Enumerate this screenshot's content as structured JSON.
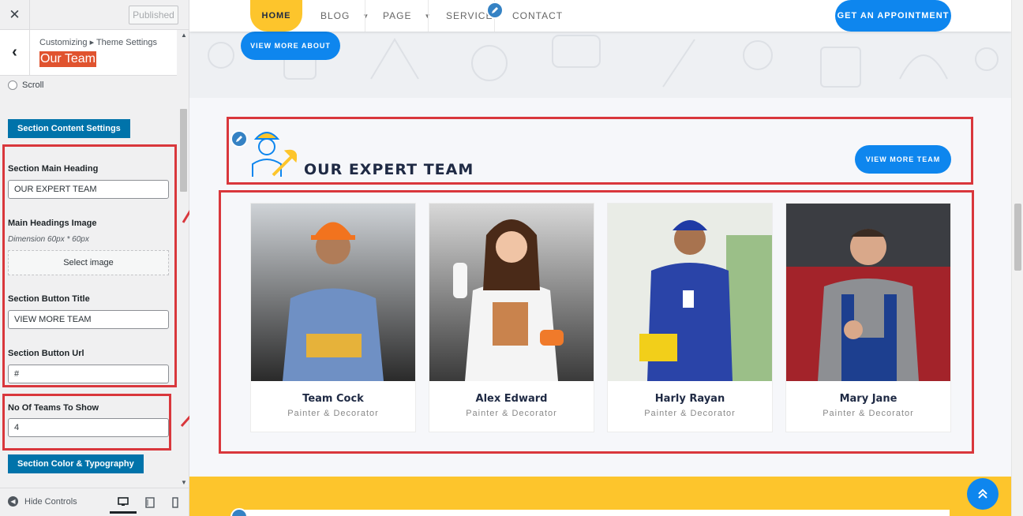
{
  "sidebar": {
    "published_label": "Published",
    "breadcrumb": "Customizing ▸ Theme Settings",
    "section_title": "Our Team",
    "scroll_option": "Scroll",
    "content_settings_label": "Section Content Settings",
    "main_heading_label": "Section Main Heading",
    "main_heading_value": "OUR EXPERT TEAM",
    "headings_image_label": "Main Headings Image",
    "headings_image_dimension": "Dimension 60px * 60px",
    "select_image_label": "Select image",
    "button_title_label": "Section Button Title",
    "button_title_value": "VIEW MORE TEAM",
    "button_url_label": "Section Button Url",
    "button_url_value": "#",
    "teams_count_label": "No Of Teams To Show",
    "teams_count_value": "4",
    "color_typography_label": "Section Color & Typography",
    "hide_controls_label": "Hide Controls"
  },
  "nav": {
    "home": "HOME",
    "blog": "BLOG",
    "page": "PAGE",
    "service": "SERVICE",
    "contact": "CONTACT",
    "appointment": "GET AN APPOINTMENT"
  },
  "about": {
    "view_more": "VIEW MORE ABOUT"
  },
  "team": {
    "heading": "OUR EXPERT TEAM",
    "view_more": "VIEW MORE TEAM",
    "members": [
      {
        "name": "Team Cock",
        "role": "Painter & Decorator"
      },
      {
        "name": "Alex Edward",
        "role": "Painter & Decorator"
      },
      {
        "name": "Harly Rayan",
        "role": "Painter & Decorator"
      },
      {
        "name": "Mary Jane",
        "role": "Painter & Decorator"
      }
    ]
  },
  "colors": {
    "accent_yellow": "#fdc52c",
    "accent_blue": "#0e86ee",
    "wp_blue": "#0073aa",
    "highlight_red": "#d9373c",
    "title_highlight": "#e0532f"
  }
}
